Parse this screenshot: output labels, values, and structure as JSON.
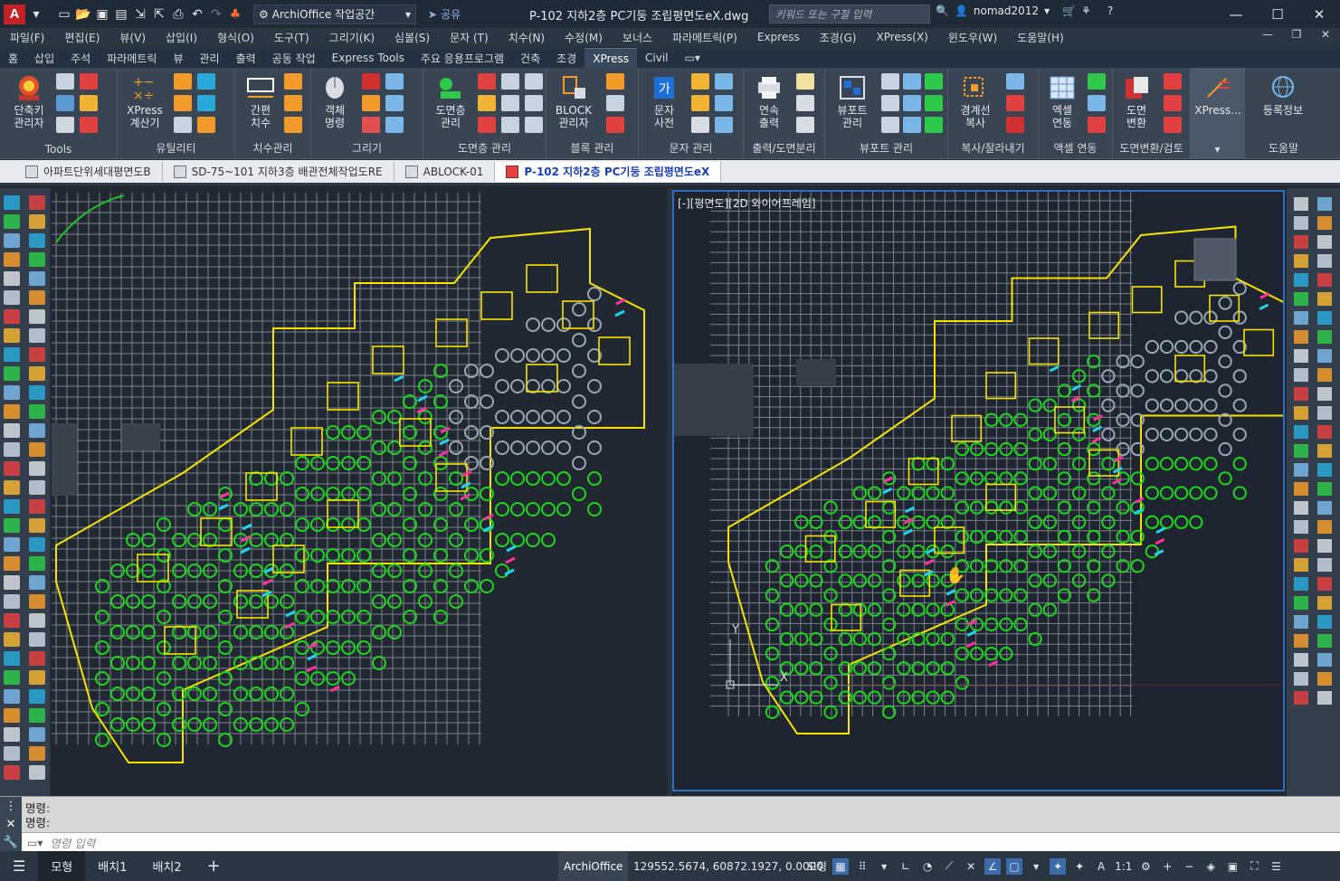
{
  "titlebar": {
    "app_icon_letter": "A",
    "workspace": "ArchiOffice 작업공간",
    "share_label": "공유",
    "document_title": "P-102 지하2층 PC기둥 조립평면도eX.dwg",
    "search_placeholder": "키워드 또는 구절 입력",
    "username": "nomad2012"
  },
  "menu": [
    "파일(F)",
    "편집(E)",
    "뷰(V)",
    "삽입(I)",
    "형식(O)",
    "도구(T)",
    "그리기(K)",
    "심볼(S)",
    "문자 (T)",
    "치수(N)",
    "수정(M)",
    "보너스",
    "파라메트릭(P)",
    "Express",
    "조경(G)",
    "XPress(X)",
    "윈도우(W)",
    "도움말(H)"
  ],
  "ribbon_tabs": [
    "홈",
    "삽입",
    "주석",
    "파라메트릭",
    "뷰",
    "관리",
    "출력",
    "공동 작업",
    "Express Tools",
    "주요 응용프로그램",
    "건축",
    "조경",
    "XPress",
    "Civil"
  ],
  "active_ribbon_tab": "XPress",
  "ribbon_panels": [
    {
      "title": "Tools",
      "buttons": [
        "단축키\n관리자"
      ]
    },
    {
      "title": "유틸리티",
      "buttons": [
        "XPress\n계산기"
      ]
    },
    {
      "title": "치수관리",
      "buttons": [
        "간편\n치수"
      ]
    },
    {
      "title": "그리기",
      "buttons": [
        "객체\n명령"
      ]
    },
    {
      "title": "도면층 관리",
      "buttons": [
        "도면층\n관리"
      ]
    },
    {
      "title": "블록 관리",
      "buttons": [
        "BLOCK\n관리자"
      ]
    },
    {
      "title": "문자 관리",
      "buttons": [
        "문자\n사전"
      ]
    },
    {
      "title": "출력/도면분리",
      "buttons": [
        "연속\n출력"
      ]
    },
    {
      "title": "뷰포트 관리",
      "buttons": [
        "뷰포트\n관리"
      ]
    },
    {
      "title": "복사/잘라내기",
      "buttons": [
        "경계선\n복사"
      ]
    },
    {
      "title": "액셀 연동",
      "buttons": [
        "엑셀\n연동"
      ]
    },
    {
      "title": "도면변환/검토",
      "buttons": [
        "도면\n변환"
      ]
    },
    {
      "title": "",
      "buttons": [
        "XPress..."
      ]
    },
    {
      "title": "도움말",
      "buttons": [
        "등록정보"
      ]
    }
  ],
  "file_tabs": [
    "아파트단위세대평면도B",
    "SD-75~101 지하3층 배관전체작업도RE",
    "ABLOCK-01",
    "P-102 지하2층 PC기둥 조립평면도eX"
  ],
  "active_file_tab": "P-102 지하2층 PC기둥 조립평면도eX",
  "viewport_right_label": "[-][평면도][2D 와이어프레임]",
  "ucs": {
    "y": "Y",
    "x": "X"
  },
  "command": {
    "history": [
      "명령:",
      "명령:"
    ],
    "placeholder": "명령 입력"
  },
  "status": {
    "layout_tabs": [
      "모형",
      "배치1",
      "배치2"
    ],
    "active_layout": "모형",
    "app_name": "ArchiOffice",
    "coordinates": "129552.5674, 60872.1927, 0.0000",
    "space": "모형",
    "scale": "1:1"
  },
  "colors": {
    "accent": "#2d6fc0",
    "wall": "#f5e400",
    "column": "#1fd61f",
    "grid": "#c8ccd2",
    "magenta": "#ff2fa0",
    "cyan": "#22d3ee",
    "canvas": "#212832"
  }
}
